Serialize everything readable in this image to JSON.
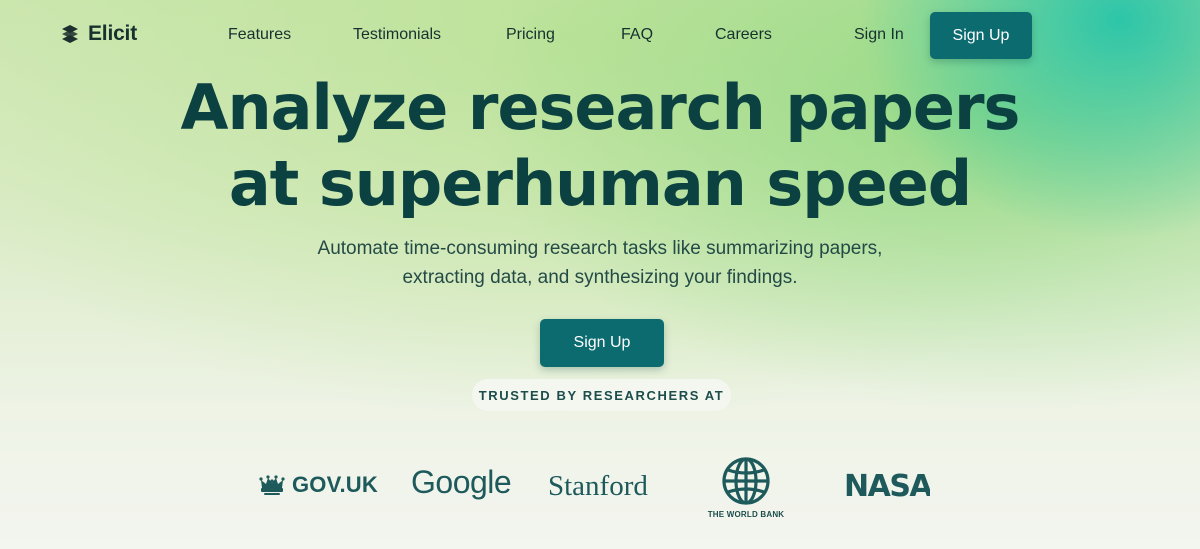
{
  "brand": {
    "name": "Elicit"
  },
  "nav": {
    "links": [
      "Features",
      "Testimonials",
      "Pricing",
      "FAQ",
      "Careers"
    ],
    "sign_in": "Sign In",
    "sign_up": "Sign Up"
  },
  "hero": {
    "headline_line1": "Analyze research papers",
    "headline_line2": "at superhuman speed",
    "subtext_line1": "Automate time-consuming research tasks like summarizing papers,",
    "subtext_line2": "extracting data, and synthesizing your findings.",
    "cta": "Sign Up",
    "trusted_label": "TRUSTED BY RESEARCHERS AT"
  },
  "organizations": {
    "gov_uk": "GOV.UK",
    "google": "Google",
    "stanford": "Stanford",
    "world_bank": "THE WORLD BANK",
    "nasa": "NASA"
  },
  "colors": {
    "primary_button": "#0b6b6f",
    "headline": "#0c4141",
    "logo_color": "#1e5a5c"
  }
}
